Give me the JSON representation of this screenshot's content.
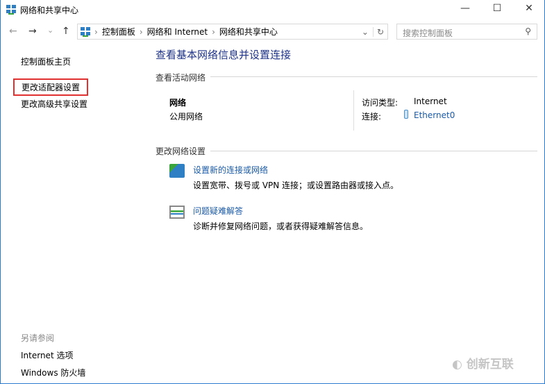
{
  "window": {
    "title": "网络和共享中心",
    "minimize": "—",
    "maximize": "☐",
    "close": "✕"
  },
  "nav": {
    "back": "←",
    "forward": "→",
    "recent": "⌄",
    "up": "↑",
    "breadcrumb": [
      "控制面板",
      "网络和 Internet",
      "网络和共享中心"
    ],
    "separator": "›",
    "dropdown": "⌄",
    "refresh": "↻"
  },
  "search": {
    "placeholder": "搜索控制面板",
    "icon": "⚲"
  },
  "sidebar": {
    "home": "控制面板主页",
    "items": [
      "更改适配器设置",
      "更改高级共享设置"
    ],
    "see_also_title": "另请参阅",
    "see_also": [
      "Internet 选项",
      "Windows 防火墙"
    ]
  },
  "main": {
    "heading": "查看基本网络信息并设置连接",
    "active_title": "查看活动网络",
    "network_name": "网络",
    "network_type": "公用网络",
    "access_label": "访问类型:",
    "access_value": "Internet",
    "conn_label": "连接:",
    "conn_value": "Ethernet0",
    "change_title": "更改网络设置",
    "tasks": [
      {
        "title": "设置新的连接或网络",
        "desc": "设置宽带、拨号或 VPN 连接；或设置路由器或接入点。"
      },
      {
        "title": "问题疑难解答",
        "desc": "诊断并修复网络问题，或者获得疑难解答信息。"
      }
    ]
  },
  "highlight_color": "#e03030",
  "watermark": "创新互联"
}
